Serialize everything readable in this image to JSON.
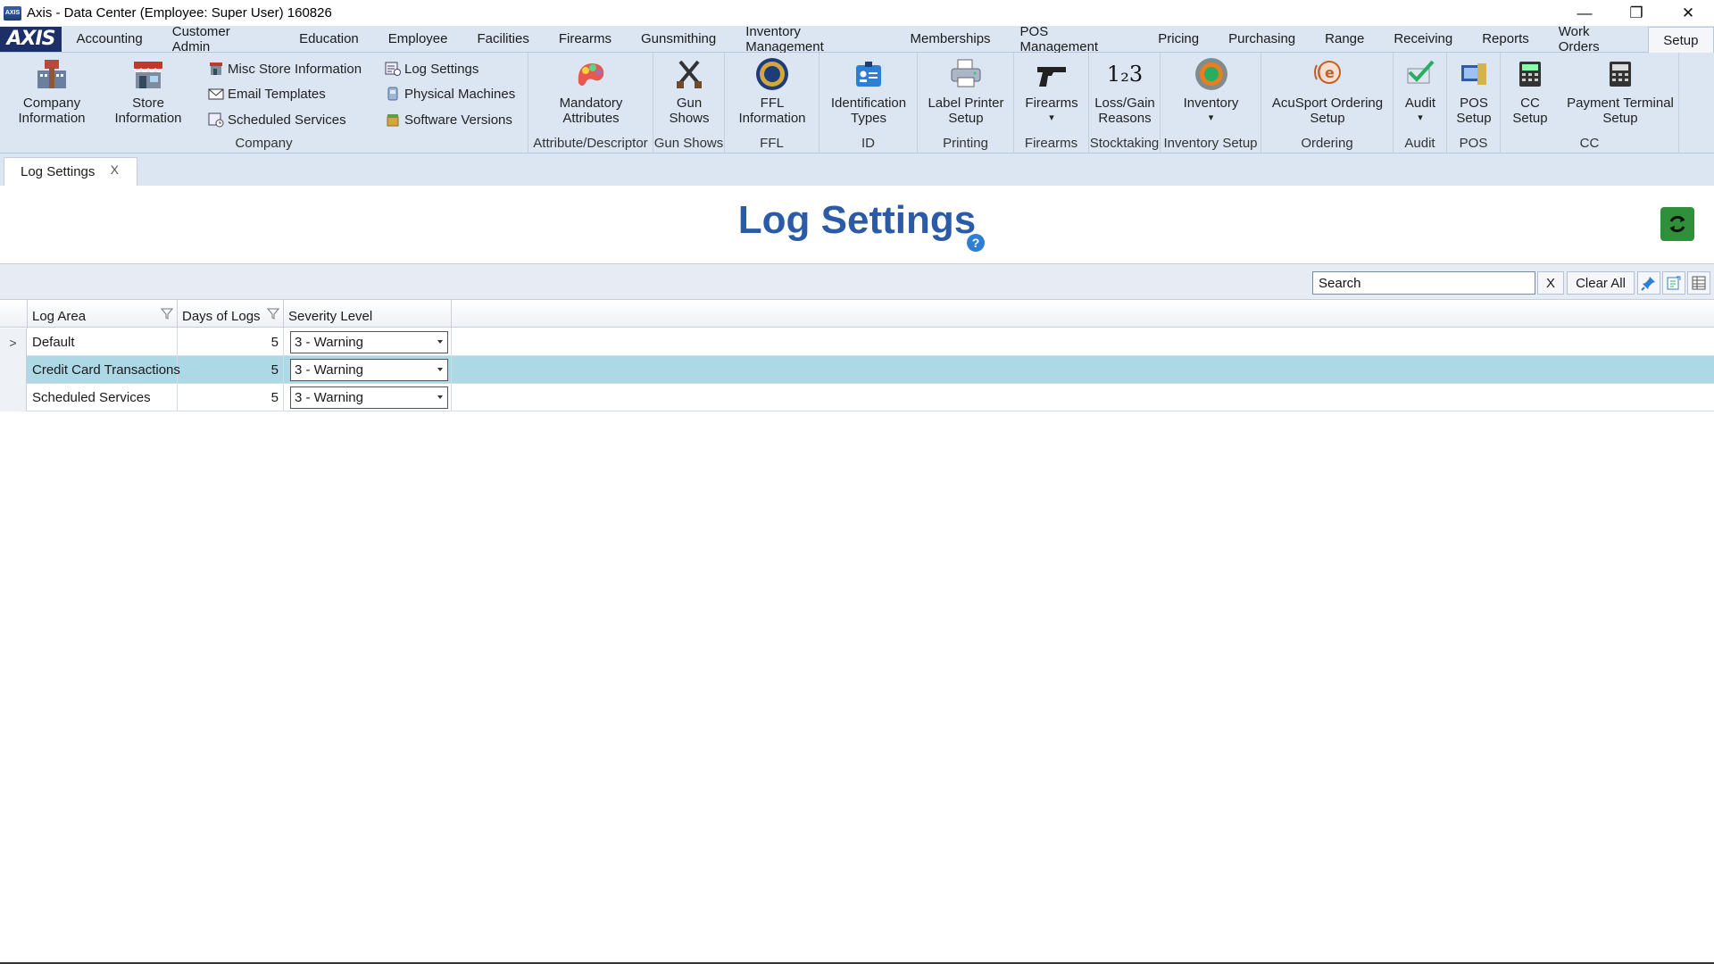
{
  "window": {
    "title": "Axis - Data Center  (Employee: Super User) 160826",
    "app_icon_text": "AXIS",
    "minimize": "—",
    "restore": "❐",
    "close": "✕"
  },
  "menubar": {
    "logo": "AXIS",
    "tabs": [
      "Accounting",
      "Customer Admin",
      "Education",
      "Employee",
      "Facilities",
      "Firearms",
      "Gunsmithing",
      "Inventory Management",
      "Memberships",
      "POS Management",
      "Pricing",
      "Purchasing",
      "Range",
      "Receiving",
      "Reports",
      "Work Orders",
      "Setup"
    ],
    "active_tab": "Setup"
  },
  "ribbon": {
    "company": {
      "label": "Company",
      "company_info": [
        "Company",
        "Information"
      ],
      "store_info": [
        "Store",
        "Information"
      ],
      "small": [
        "Misc Store Information",
        "Email Templates",
        "Scheduled Services",
        "Log Settings",
        "Physical Machines",
        "Software Versions"
      ]
    },
    "attribute": {
      "label": "Attribute/Descriptor",
      "btn": [
        "Mandatory",
        "Attributes"
      ]
    },
    "gunshows": {
      "label": "Gun Shows",
      "btn": [
        "Gun",
        "Shows"
      ]
    },
    "ffl": {
      "label": "FFL",
      "btn": [
        "FFL",
        "Information"
      ]
    },
    "id": {
      "label": "ID",
      "btn": [
        "Identification",
        "Types"
      ]
    },
    "printing": {
      "label": "Printing",
      "btn": [
        "Label Printer",
        "Setup"
      ]
    },
    "firearms": {
      "label": "Firearms",
      "btn": [
        "Firearms",
        "▾"
      ]
    },
    "stocktaking": {
      "label": "Stocktaking",
      "btn": [
        "Loss/Gain",
        "Reasons"
      ],
      "icon_text": "1₂3"
    },
    "inventory": {
      "label": "Inventory Setup",
      "btn": [
        "Inventory",
        "▾"
      ]
    },
    "ordering": {
      "label": "Ordering",
      "btn": [
        "AcuSport Ordering",
        "Setup"
      ]
    },
    "audit": {
      "label": "Audit",
      "btn": [
        "Audit",
        "▾"
      ]
    },
    "pos": {
      "label": "POS",
      "btn": [
        "POS",
        "Setup"
      ]
    },
    "cc": {
      "label": "CC",
      "btn1": [
        "CC",
        "Setup"
      ],
      "btn2": [
        "Payment Terminal",
        "Setup"
      ]
    }
  },
  "doc_tabs": [
    {
      "label": "Log Settings",
      "close": "X"
    }
  ],
  "page": {
    "title": "Log Settings",
    "help": "?"
  },
  "toolbar": {
    "search_value": "Search",
    "search_clear": "X",
    "clear_all": "Clear All"
  },
  "grid": {
    "columns": [
      "Log Area",
      "Days of Logs",
      "Severity Level"
    ],
    "rows": [
      {
        "indicator": ">",
        "log_area": "Default",
        "days": "5",
        "severity": "3 - Warning"
      },
      {
        "indicator": "",
        "log_area": "Credit Card Transactions",
        "days": "5",
        "severity": "3 - Warning"
      },
      {
        "indicator": "",
        "log_area": "Scheduled Services",
        "days": "5",
        "severity": "3 - Warning"
      }
    ],
    "selected_row": 1
  },
  "colors": {
    "ribbon_bg": "#dce6f2",
    "title_blue": "#2b5aa7",
    "selected_row": "#add8e6",
    "refresh_green": "#2f8f3a"
  }
}
